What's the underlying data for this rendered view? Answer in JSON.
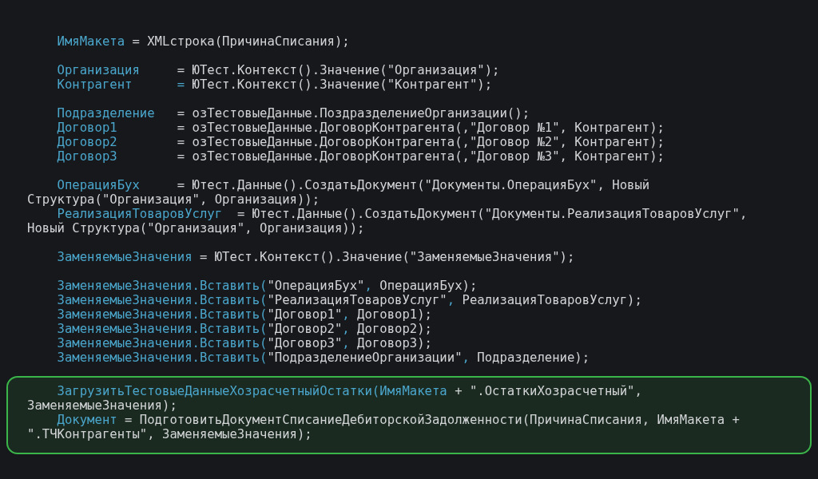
{
  "code_blocks": [
    {
      "highlighted": false,
      "lines": [
        [
          {
            "kind": "ident",
            "text": "    ИмяМакета"
          },
          {
            "kind": "plain",
            "text": " = XMLстрока(ПричинаСписания);"
          }
        ]
      ]
    },
    {
      "highlighted": false,
      "lines": [
        [
          {
            "kind": "ident",
            "text": "    Организация"
          },
          {
            "kind": "plain",
            "text": "     = ЮТест.Контекст().Значение(\"Организация\");"
          }
        ],
        [
          {
            "kind": "ident",
            "text": "    Контрагент      ="
          },
          {
            "kind": "plain",
            "text": " ЮТест.Контекст().Значение(\"Контрагент\");"
          }
        ]
      ]
    },
    {
      "highlighted": false,
      "lines": [
        [
          {
            "kind": "ident",
            "text": "    Подразделение"
          },
          {
            "kind": "plain",
            "text": "   = озТестовыеДанные.ПоздразделениеОрганизации();"
          }
        ],
        [
          {
            "kind": "ident",
            "text": "    Договор1"
          },
          {
            "kind": "plain",
            "text": "        = озТестовыеДанные.ДоговорКонтрагента(,\"Договор №1\", Контрагент);"
          }
        ],
        [
          {
            "kind": "ident",
            "text": "    Договор2"
          },
          {
            "kind": "plain",
            "text": "        = озТестовыеДанные.ДоговорКонтрагента(,\"Договор №2\", Контрагент);"
          }
        ],
        [
          {
            "kind": "ident",
            "text": "    Договор3"
          },
          {
            "kind": "plain",
            "text": "        = озТестовыеДанные.ДоговорКонтрагента(,\"Договор №3\", Контрагент);"
          }
        ]
      ]
    },
    {
      "highlighted": false,
      "lines": [
        [
          {
            "kind": "ident",
            "text": "    ОперацияБух"
          },
          {
            "kind": "plain",
            "text": "     = Ютест.Данные().СоздатьДокумент(\"Документы.ОперацияБух\", Новый"
          }
        ],
        [
          {
            "kind": "plain",
            "text": "Структура(\"Организация\", Организация));"
          }
        ],
        [
          {
            "kind": "ident",
            "text": "    РеализацияТоваровУслуг"
          },
          {
            "kind": "plain",
            "text": "  = Ютест.Данные().СоздатьДокумент(\"Документы.РеализацияТоваровУслуг\","
          }
        ],
        [
          {
            "kind": "plain",
            "text": "Новый Структура(\"Организация\", Организация));"
          }
        ]
      ]
    },
    {
      "highlighted": false,
      "lines": [
        [
          {
            "kind": "ident",
            "text": "    ЗаменяемыеЗначения"
          },
          {
            "kind": "plain",
            "text": " = ЮТест.Контекст().Значение(\"ЗаменяемыеЗначения\");"
          }
        ]
      ]
    },
    {
      "highlighted": false,
      "lines": [
        [
          {
            "kind": "ident",
            "text": "    ЗаменяемыеЗначения.Вставить("
          },
          {
            "kind": "plain",
            "text": "\"ОперацияБух\""
          },
          {
            "kind": "ident",
            "text": ","
          },
          {
            "kind": "plain",
            "text": " ОперацияБух);"
          }
        ],
        [
          {
            "kind": "ident",
            "text": "    ЗаменяемыеЗначения.Вставить("
          },
          {
            "kind": "plain",
            "text": "\"РеализацияТоваровУслуг\""
          },
          {
            "kind": "ident",
            "text": ","
          },
          {
            "kind": "plain",
            "text": " РеализацияТоваровУслуг);"
          }
        ],
        [
          {
            "kind": "ident",
            "text": "    ЗаменяемыеЗначения.Вставить("
          },
          {
            "kind": "plain",
            "text": "\"Договор1\""
          },
          {
            "kind": "ident",
            "text": ","
          },
          {
            "kind": "plain",
            "text": " Договор1);"
          }
        ],
        [
          {
            "kind": "ident",
            "text": "    ЗаменяемыеЗначения.Вставить("
          },
          {
            "kind": "plain",
            "text": "\"Договор2\""
          },
          {
            "kind": "ident",
            "text": ","
          },
          {
            "kind": "plain",
            "text": " Договор2);"
          }
        ],
        [
          {
            "kind": "ident",
            "text": "    ЗаменяемыеЗначения.Вставить("
          },
          {
            "kind": "plain",
            "text": "\"Договор3\""
          },
          {
            "kind": "ident",
            "text": ","
          },
          {
            "kind": "plain",
            "text": " Договор3);"
          }
        ],
        [
          {
            "kind": "ident",
            "text": "    ЗаменяемыеЗначения.Вставить("
          },
          {
            "kind": "plain",
            "text": "\"ПодразделениеОрганизации\""
          },
          {
            "kind": "ident",
            "text": ","
          },
          {
            "kind": "plain",
            "text": " Подразделение);"
          }
        ]
      ]
    },
    {
      "highlighted": true,
      "lines": [
        [
          {
            "kind": "ident",
            "text": "    ЗагрузитьТестовыеДанныеХозрасчетныйОстатки(ИмяМакета"
          },
          {
            "kind": "plain",
            "text": " + \".ОстаткиХозрасчетный\","
          }
        ],
        [
          {
            "kind": "plain",
            "text": "ЗаменяемыеЗначения);"
          }
        ],
        [
          {
            "kind": "ident",
            "text": "    Документ"
          },
          {
            "kind": "plain",
            "text": " = ПодготовитьДокументСписаниеДебиторскойЗадолженности(ПричинаСписания, ИмяМакета +"
          }
        ],
        [
          {
            "kind": "plain",
            "text": "\".ТЧКонтрагенты\", ЗаменяемыеЗначения);"
          }
        ]
      ]
    }
  ]
}
